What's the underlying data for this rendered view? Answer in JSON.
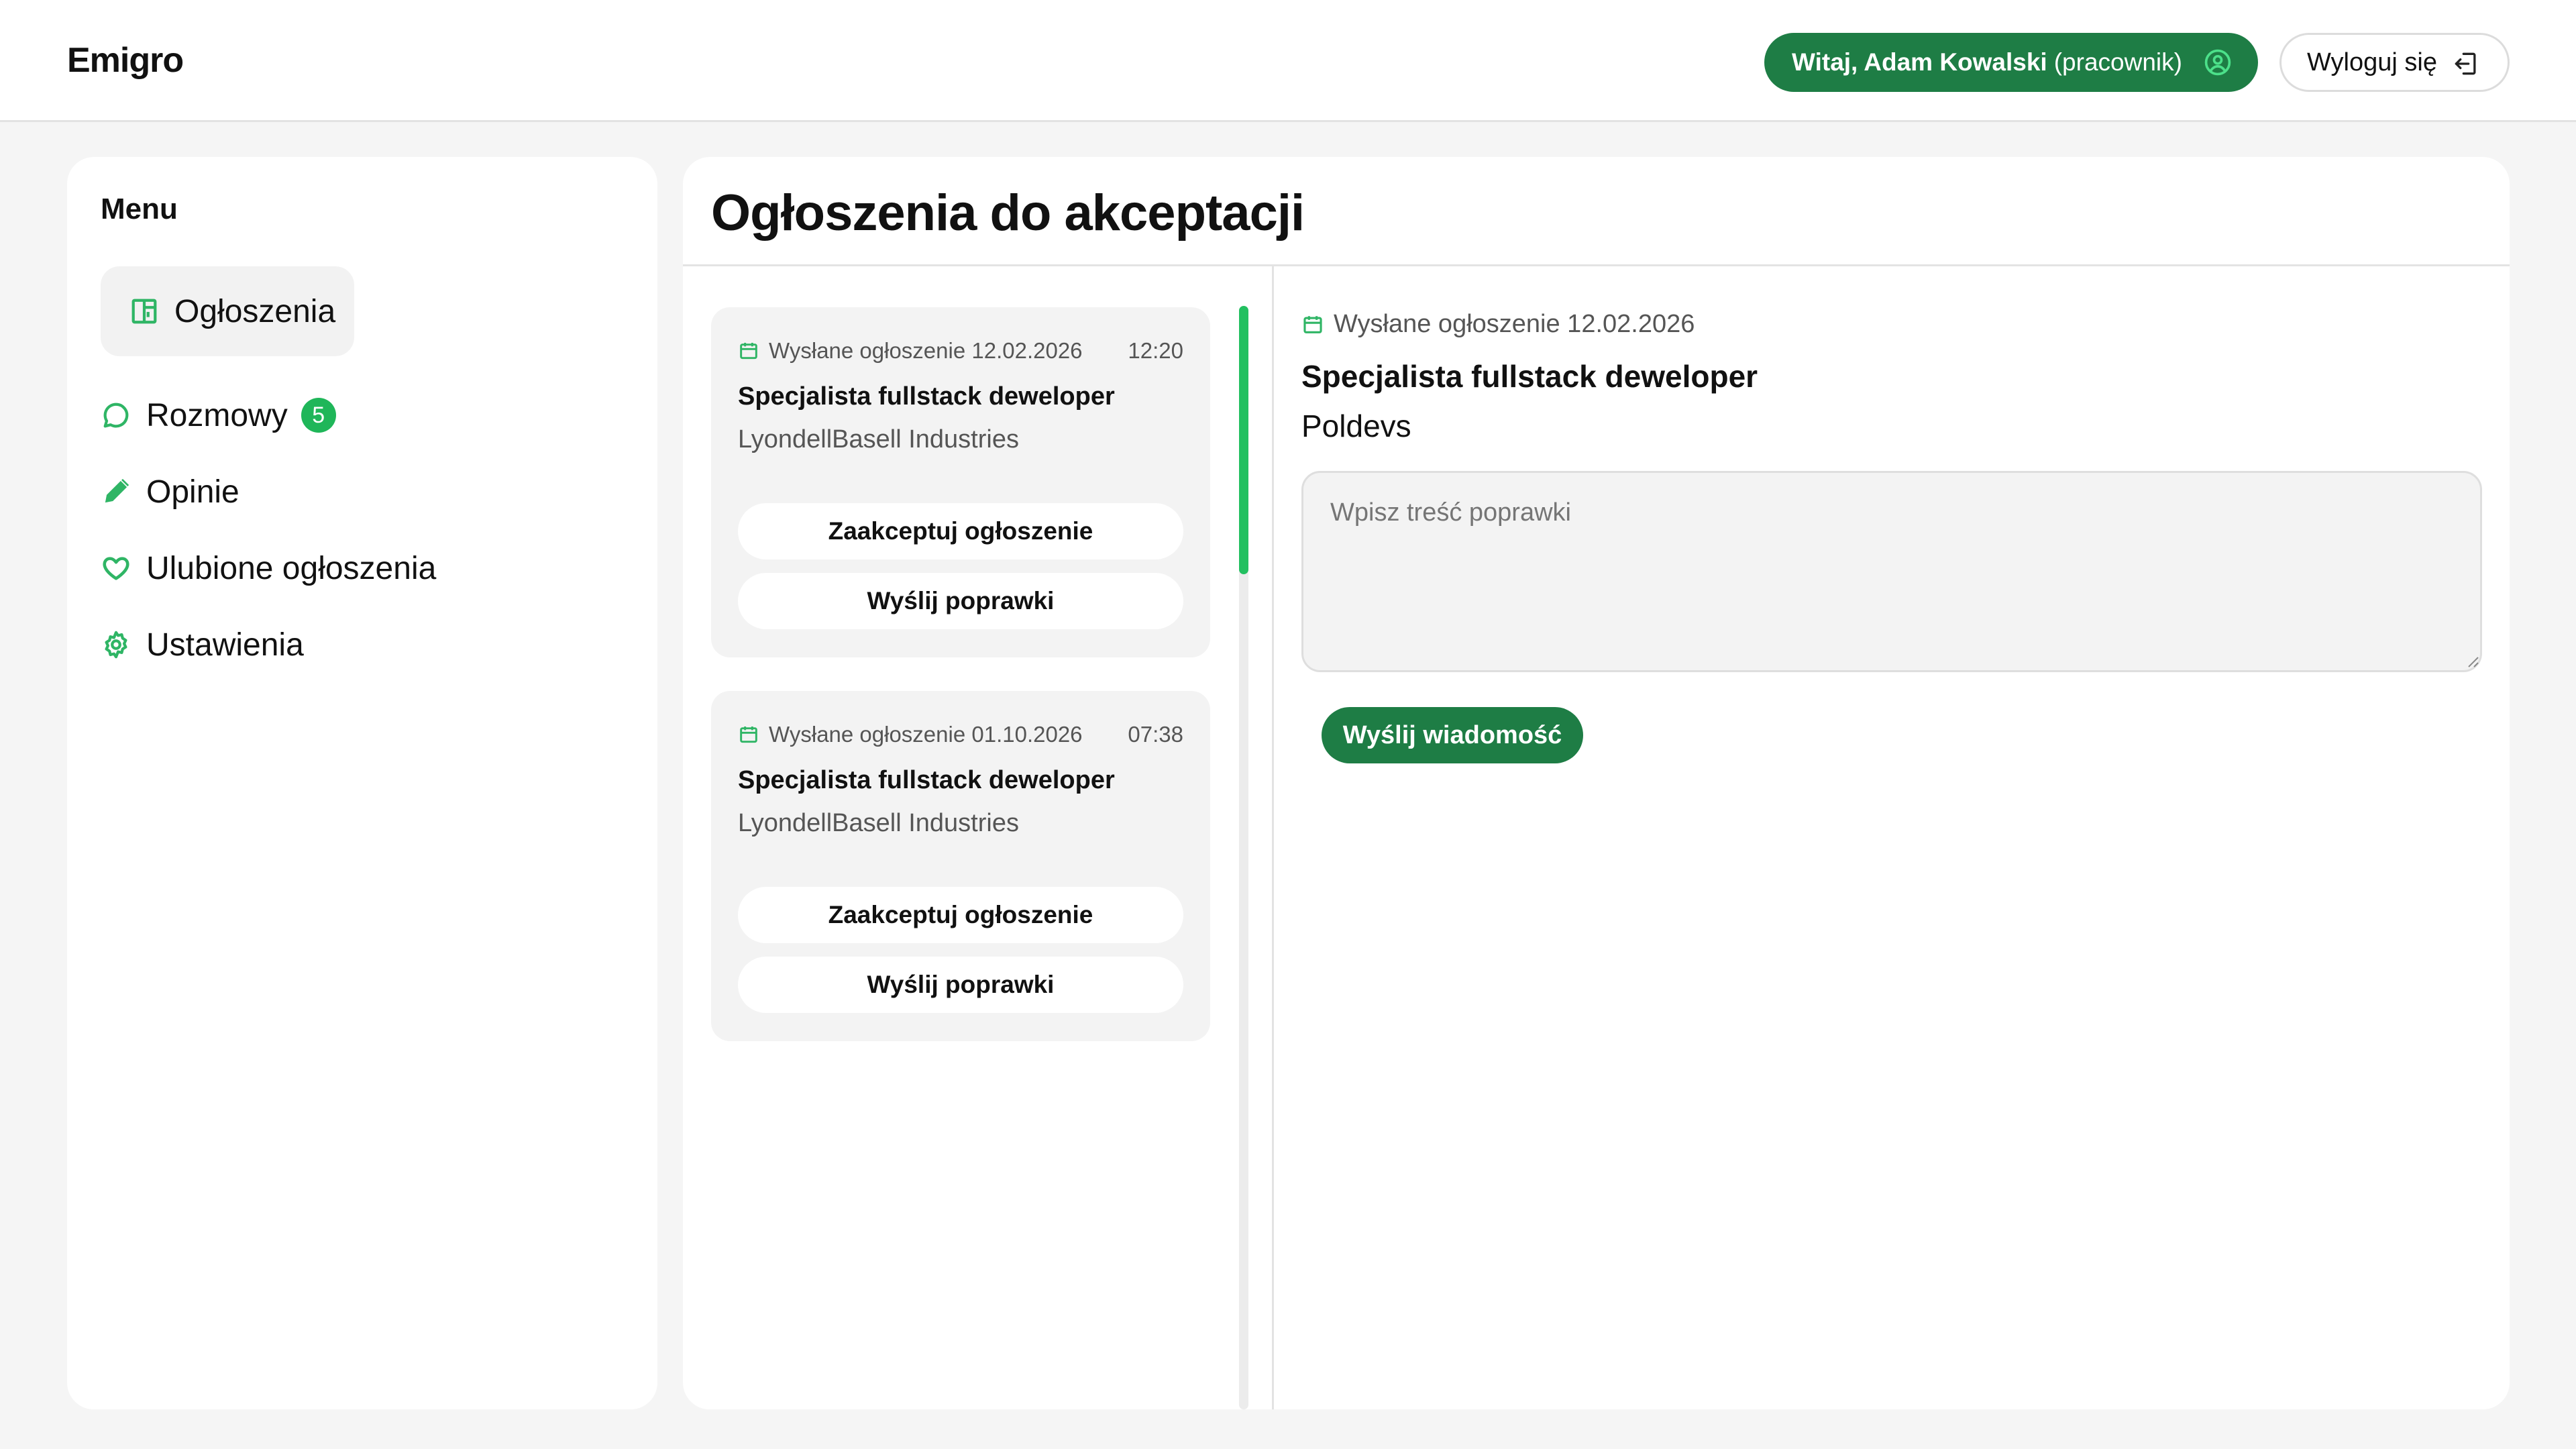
{
  "header": {
    "logo": "Emigro",
    "welcome_greeting": "Witaj, Adam Kowalski",
    "welcome_role": "(pracownik)",
    "user_icon": "user-circle-icon",
    "logout_label": "Wyloguj się",
    "logout_icon": "logout-icon"
  },
  "sidebar": {
    "title": "Menu",
    "items": [
      {
        "label": "Ogłoszenia",
        "icon": "board-icon",
        "active": true
      },
      {
        "label": "Rozmowy",
        "icon": "chat-bubble-icon",
        "badge": "5"
      },
      {
        "label": "Opinie",
        "icon": "pencil-icon"
      },
      {
        "label": "Ulubione ogłoszenia",
        "icon": "heart-icon"
      },
      {
        "label": "Ustawienia",
        "icon": "gear-icon"
      }
    ]
  },
  "main": {
    "title": "Ogłoszenia do akceptacji",
    "cards": [
      {
        "sent_label": "Wysłane ogłoszenie 12.02.2026",
        "time": "12:20",
        "job_title": "Specjalista fullstack deweloper",
        "company": "LyondellBasell Industries",
        "accept_label": "Zaakceptuj ogłoszenie",
        "corrections_label": "Wyślij poprawki"
      },
      {
        "sent_label": "Wysłane ogłoszenie 01.10.2026",
        "time": "07:38",
        "job_title": "Specjalista fullstack deweloper",
        "company": "LyondellBasell Industries",
        "accept_label": "Zaakceptuj ogłoszenie",
        "corrections_label": "Wyślij poprawki"
      }
    ],
    "detail": {
      "sent_label": "Wysłane ogłoszenie 12.02.2026",
      "job_title": "Specjalista fullstack deweloper",
      "company": "Poldevs",
      "textarea_placeholder": "Wpisz treść poprawki",
      "textarea_value": "",
      "send_label": "Wyślij wiadomość"
    }
  },
  "colors": {
    "accent_dark": "#1e7d45",
    "accent_bright": "#22c060",
    "icon_green": "#2fb565"
  }
}
